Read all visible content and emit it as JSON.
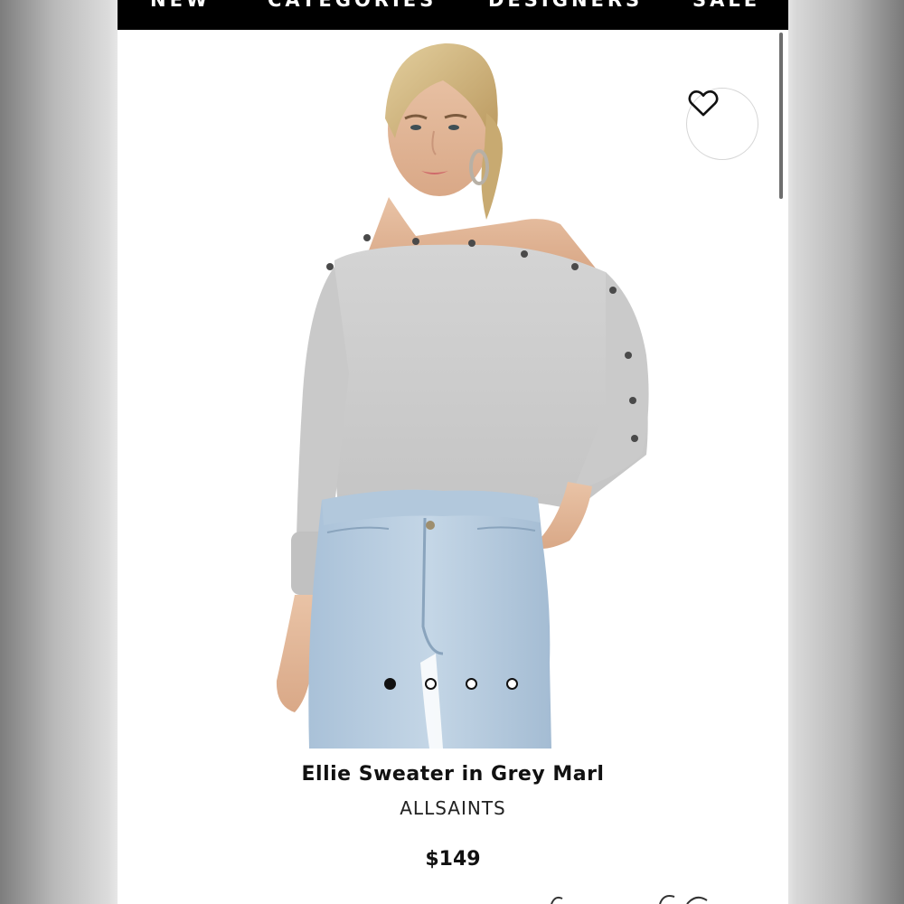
{
  "nav": {
    "items": [
      {
        "label": "NEW"
      },
      {
        "label": "CATEGORIES"
      },
      {
        "label": "DESIGNERS"
      },
      {
        "label": "SALE"
      }
    ]
  },
  "product": {
    "title": "Ellie Sweater in Grey Marl",
    "brand": "ALLSAINTS",
    "price": "$149"
  },
  "gallery": {
    "image_count": 4,
    "active_index": 0
  },
  "icons": {
    "favorite": "heart-icon"
  }
}
